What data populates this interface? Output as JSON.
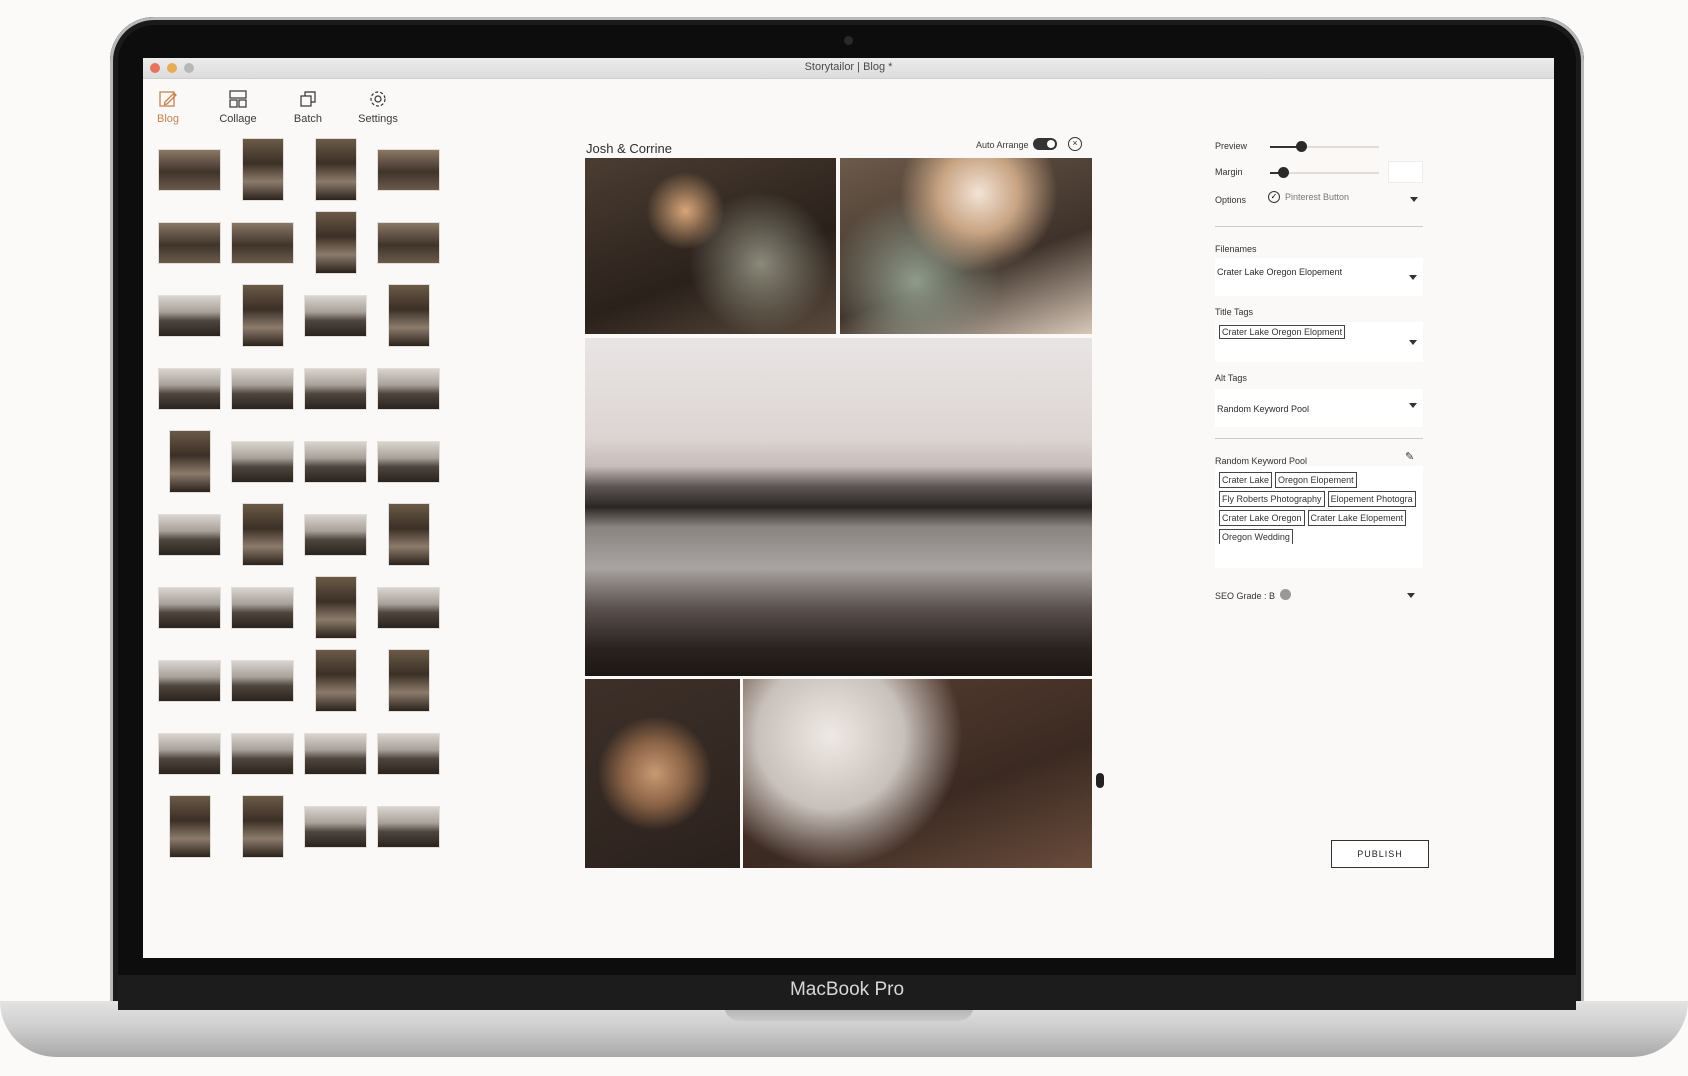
{
  "device": {
    "label": "MacBook Pro"
  },
  "window": {
    "title": "Storytailor | Blog *"
  },
  "nav": [
    {
      "label": "Blog",
      "icon": "edit-icon",
      "active": true
    },
    {
      "label": "Collage",
      "icon": "collage-icon",
      "active": false
    },
    {
      "label": "Batch",
      "icon": "batch-icon",
      "active": false
    },
    {
      "label": "Settings",
      "icon": "gear-icon",
      "active": false
    }
  ],
  "thumbnails": {
    "rows": 10,
    "columns": 4
  },
  "blog": {
    "title": "Josh & Corrine",
    "auto_arrange_label": "Auto Arrange",
    "auto_arrange_on": true,
    "photos": 5
  },
  "panel": {
    "preview_label": "Preview",
    "preview_value": 0.28,
    "margin_label": "Margin",
    "margin_value": 0.12,
    "options_label": "Options",
    "options_value": "Pinterest Button",
    "filenames_label": "Filenames",
    "filenames_value": "Crater Lake Oregon Elopement",
    "title_tags_label": "Title Tags",
    "title_tags": [
      "Crater Lake Oregon Elopment"
    ],
    "alt_tags_label": "Alt Tags",
    "alt_tags_value": "Random Keyword Pool",
    "keyword_pool_label": "Random Keyword Pool",
    "keyword_pool": [
      "Crater Lake",
      "Oregon Elopement",
      "Fly Roberts Photography",
      "Elopement Photogra",
      "Crater Lake Oregon",
      "Crater Lake Elopement",
      "Oregon Wedding"
    ],
    "seo_grade_label": "SEO Grade : B",
    "publish_label": "PUBLISH"
  },
  "colors": {
    "accent": "#c7834e",
    "dark": "#2a2a2a",
    "seo_dot": "#999999"
  }
}
